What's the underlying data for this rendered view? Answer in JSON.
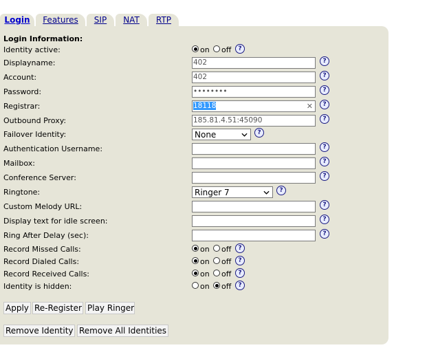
{
  "tabs": [
    "Login",
    "Features",
    "SIP",
    "NAT",
    "RTP"
  ],
  "section_title": "Login Information:",
  "radio_labels": {
    "on": "on",
    "off": "off"
  },
  "help_glyph": "?",
  "fields": {
    "identity_active": {
      "label": "Identity active:",
      "value": "on"
    },
    "displayname": {
      "label": "Displayname:",
      "value": "402"
    },
    "account": {
      "label": "Account:",
      "value": "402"
    },
    "password": {
      "label": "Password:",
      "value": "••••••••"
    },
    "registrar": {
      "label": "Registrar:",
      "value": "18118"
    },
    "outbound_proxy": {
      "label": "Outbound Proxy:",
      "value": "185.81.4.51:45090"
    },
    "failover_identity": {
      "label": "Failover Identity:",
      "value": "None"
    },
    "auth_username": {
      "label": "Authentication Username:",
      "value": ""
    },
    "mailbox": {
      "label": "Mailbox:",
      "value": ""
    },
    "conference_server": {
      "label": "Conference Server:",
      "value": ""
    },
    "ringtone": {
      "label": "Ringtone:",
      "value": "Ringer 7"
    },
    "custom_melody_url": {
      "label": "Custom Melody URL:",
      "value": ""
    },
    "idle_text": {
      "label": "Display text for idle screen:",
      "value": ""
    },
    "ring_after_delay": {
      "label": "Ring After Delay (sec):",
      "value": ""
    },
    "record_missed": {
      "label": "Record Missed Calls:",
      "value": "on"
    },
    "record_dialed": {
      "label": "Record Dialed Calls:",
      "value": "on"
    },
    "record_received": {
      "label": "Record Received Calls:",
      "value": "on"
    },
    "identity_hidden": {
      "label": "Identity is hidden:",
      "value": "off"
    }
  },
  "buttons": {
    "apply": "Apply",
    "reregister": "Re-Register",
    "play_ringer": "Play Ringer",
    "remove_identity": "Remove Identity",
    "remove_all": "Remove All Identities"
  }
}
